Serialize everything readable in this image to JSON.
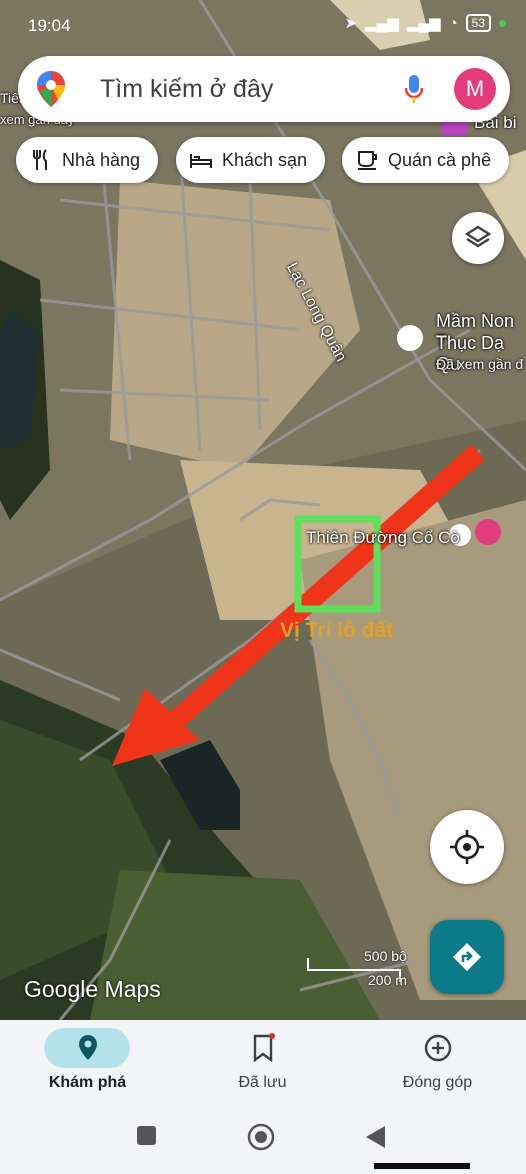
{
  "status_bar": {
    "time": "19:04",
    "battery": "53"
  },
  "search": {
    "placeholder": "Tìm kiếm ở đây",
    "avatar_letter": "M"
  },
  "chips": [
    {
      "label": "Nhà hàng",
      "icon": "fork-knife-icon"
    },
    {
      "label": "Khách sạn",
      "icon": "bed-icon"
    },
    {
      "label": "Quán cà phê",
      "icon": "coffee-cup-icon"
    }
  ],
  "map": {
    "labels": {
      "left_edge_1": "Tiên",
      "left_edge_2": "xem gần đây",
      "top_right": "Bãi bi",
      "road": "Lạc Long Quân",
      "poi_1_line1": "Mầm Non T",
      "poi_1_line2": "Thục Dạ Qu",
      "poi_1_line3": "Đã xem gần đ",
      "poi_2": "Thiên Đường Cổ Cò",
      "plot": "Vị Trí lô đất"
    },
    "scale_top": "500 bộ",
    "scale_bottom": "200 m",
    "watermark": "Google Maps",
    "annotation_colors": {
      "arrow": "#f0341a",
      "box": "#5ee05a",
      "plot_text": "#e0a224"
    }
  },
  "bottom_nav": [
    {
      "label": "Khám phá",
      "icon": "location-pin-icon",
      "active": true
    },
    {
      "label": "Đã lưu",
      "icon": "bookmark-icon",
      "active": false
    },
    {
      "label": "Đóng góp",
      "icon": "add-circle-icon",
      "active": false
    }
  ],
  "accent_color": "#0b7b8a"
}
